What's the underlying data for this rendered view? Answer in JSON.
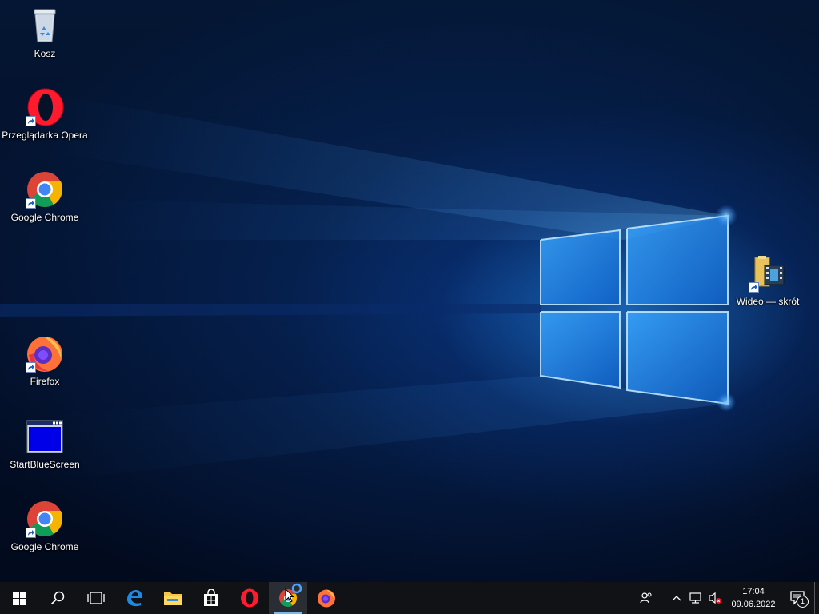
{
  "desktop": {
    "icons": [
      {
        "label": "Kosz",
        "icon": "recycle-bin-icon"
      },
      {
        "label": "Przeglądarka Opera",
        "icon": "opera-icon"
      },
      {
        "label": "Google Chrome",
        "icon": "chrome-icon"
      },
      {
        "label": "Firefox",
        "icon": "firefox-icon"
      },
      {
        "label": "StartBlueScreen",
        "icon": "blue-window-icon"
      },
      {
        "label": "Google Chrome",
        "icon": "chrome-icon"
      },
      {
        "label": "Wideo — skrót",
        "icon": "video-folder-icon"
      }
    ]
  },
  "taskbar": {
    "buttons": [
      {
        "name": "start-button",
        "icon": "windows-logo-icon"
      },
      {
        "name": "search-button",
        "icon": "search-icon"
      },
      {
        "name": "task-view-button",
        "icon": "task-view-icon"
      },
      {
        "name": "edge-button",
        "icon": "edge-icon"
      },
      {
        "name": "file-explorer-button",
        "icon": "folder-icon"
      },
      {
        "name": "store-button",
        "icon": "store-icon"
      },
      {
        "name": "opera-button",
        "icon": "opera-icon"
      },
      {
        "name": "chrome-button",
        "icon": "chrome-icon",
        "state": "active"
      },
      {
        "name": "firefox-button",
        "icon": "firefox-icon"
      }
    ],
    "tray": {
      "icons": [
        "people-icon",
        "chevron-up-icon",
        "network-icon",
        "volume-muted-icon"
      ],
      "time": "17:04",
      "date": "09.06.2022",
      "notification_count": "1"
    }
  },
  "colors": {
    "taskbar_bg": "#101216",
    "accent": "#76b9ed",
    "wallpaper_glow": "#2896ff"
  }
}
